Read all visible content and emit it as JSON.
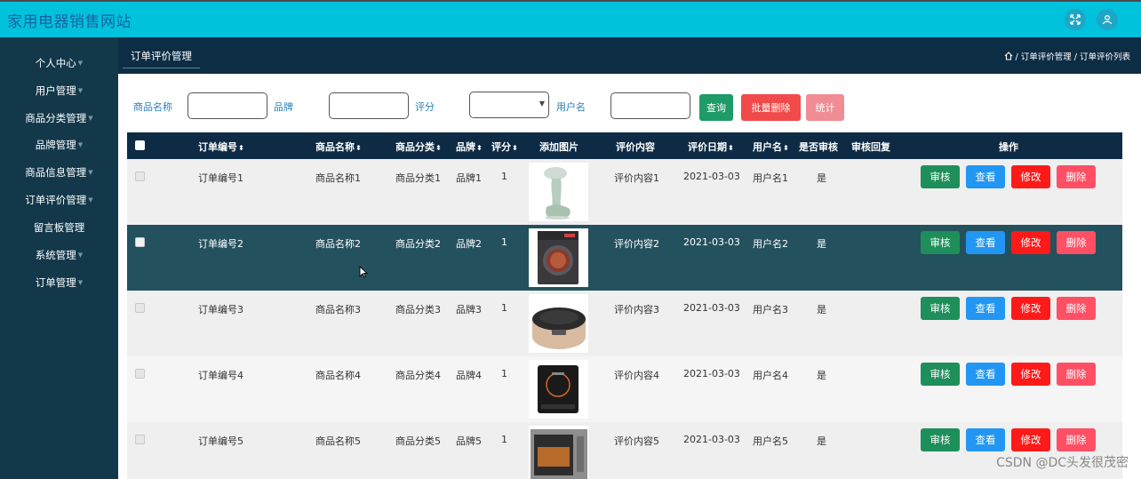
{
  "app": {
    "title": "家用电器销售网站"
  },
  "header": {
    "fullscreen_icon": "expand-icon",
    "user_icon": "user-icon"
  },
  "sidebar": {
    "items": [
      {
        "label": "个人中心"
      },
      {
        "label": "用户管理"
      },
      {
        "label": "商品分类管理"
      },
      {
        "label": "品牌管理"
      },
      {
        "label": "商品信息管理"
      },
      {
        "label": "订单评价管理"
      },
      {
        "label": "留言板管理"
      },
      {
        "label": "系统管理"
      },
      {
        "label": "订单管理"
      }
    ]
  },
  "page": {
    "tab": "订单评价管理",
    "breadcrumb": "/ 订单评价管理 / 订单评价列表"
  },
  "search": {
    "name_label": "商品名称",
    "brand_label": "品牌",
    "rating_label": "评分",
    "user_label": "用户名",
    "query_button": "查询",
    "batch_delete_button": "批量删除",
    "stats_button": "统计"
  },
  "table": {
    "headers": {
      "order_no": "订单编号",
      "product_name": "商品名称",
      "category": "商品分类",
      "brand": "品牌",
      "rating": "评分",
      "image": "添加图片",
      "content": "评价内容",
      "date": "评价日期",
      "user": "用户名",
      "reviewed": "是否审核",
      "reply": "审核回复",
      "actions": "操作"
    },
    "sort_icon": "sort-icon",
    "rows": [
      {
        "order_no": "订单编号1",
        "product_name": "商品名称1",
        "category": "商品分类1",
        "brand": "品牌1",
        "rating": "1",
        "image": "garment-steamer",
        "content": "评价内容1",
        "date": "2021-03-03",
        "user": "用户名1",
        "reviewed": "是"
      },
      {
        "order_no": "订单编号2",
        "product_name": "商品名称2",
        "category": "商品分类2",
        "brand": "品牌2",
        "rating": "1",
        "image": "washing-machine",
        "content": "评价内容2",
        "date": "2021-03-03",
        "user": "用户名2",
        "reviewed": "是"
      },
      {
        "order_no": "订单编号3",
        "product_name": "商品名称3",
        "category": "商品分类3",
        "brand": "品牌3",
        "rating": "1",
        "image": "rice-cooker",
        "content": "评价内容3",
        "date": "2021-03-03",
        "user": "用户名3",
        "reviewed": "是"
      },
      {
        "order_no": "订单编号4",
        "product_name": "商品名称4",
        "category": "商品分类4",
        "brand": "品牌4",
        "rating": "1",
        "image": "induction-cooker",
        "content": "评价内容4",
        "date": "2021-03-03",
        "user": "用户名4",
        "reviewed": "是"
      },
      {
        "order_no": "订单编号5",
        "product_name": "商品名称5",
        "category": "商品分类5",
        "brand": "品牌5",
        "rating": "1",
        "image": "microwave-oven",
        "content": "评价内容5",
        "date": "2021-03-03",
        "user": "用户名5",
        "reviewed": "是"
      }
    ],
    "actions": {
      "review": "审核",
      "view": "查看",
      "edit": "修改",
      "delete": "删除"
    }
  },
  "watermark": "CSDN @DC头发很茂密",
  "colors": {
    "topbar": "#00c2dd",
    "sidebar": "#12384a",
    "table_header": "#0d2b45",
    "row_highlight": "#24515e",
    "review": "#1e8f5a",
    "view": "#2196f3",
    "edit": "#ff1a1a",
    "delete": "#ff4f64"
  }
}
